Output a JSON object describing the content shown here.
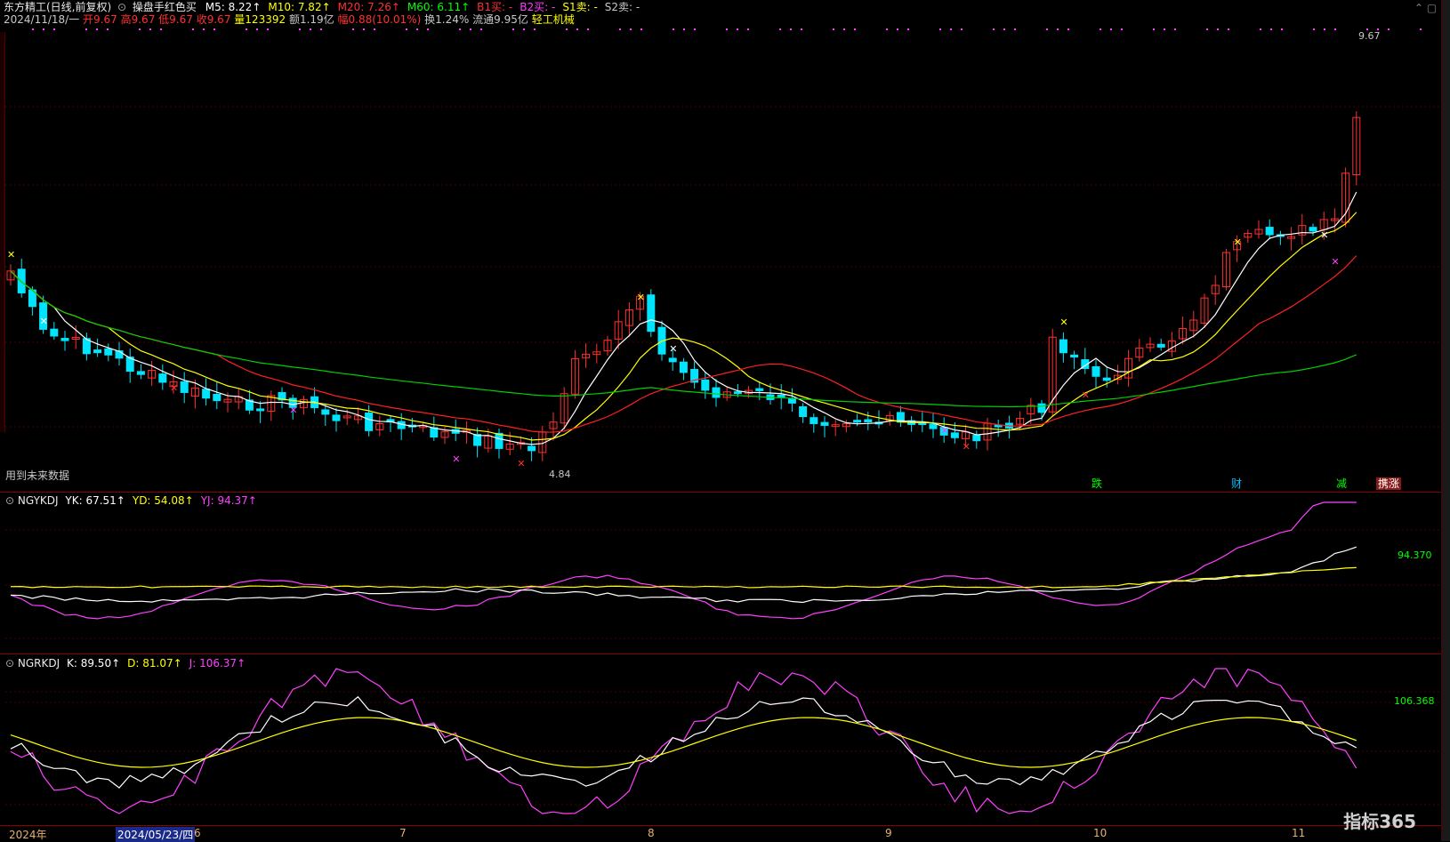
{
  "header": {
    "title": "东方精工(日线,前复权)",
    "indicator_name": "操盘手红色买",
    "ma": [
      {
        "label": "M5:",
        "value": "8.22↑",
        "color": "#ffffff"
      },
      {
        "label": "M10:",
        "value": "7.82↑",
        "color": "#ffff00"
      },
      {
        "label": "M20:",
        "value": "7.26↑",
        "color": "#ff3030"
      },
      {
        "label": "M60:",
        "value": "6.11↑",
        "color": "#00ff00"
      },
      {
        "label": "B1买:",
        "value": "-",
        "color": "#ff3030"
      },
      {
        "label": "B2买:",
        "value": "-",
        "color": "#ff40ff"
      },
      {
        "label": "S1卖:",
        "value": "-",
        "color": "#ffff00"
      },
      {
        "label": "S2卖:",
        "value": "-",
        "color": "#c8c8c8"
      }
    ]
  },
  "quote": {
    "date": "2024/11/18/一",
    "open": "开9.67",
    "high": "高9.67",
    "low": "低9.67",
    "close": "收9.67",
    "volume": "量123392",
    "amount": "额1.19亿",
    "change": "幅0.88(10.01%)",
    "turnover": "换1.24%",
    "float": "流通9.95亿",
    "sector": "轻工机械"
  },
  "main_chart": {
    "note": "用到未来数据",
    "high_label": "9.67",
    "low_label": "4.84",
    "signal_labels": [
      {
        "text": "跌",
        "color": "#00ff00"
      },
      {
        "text": "财",
        "color": "#00c0ff"
      },
      {
        "text": "减",
        "color": "#00ff00"
      },
      {
        "text": "携涨",
        "color": "#ff8040"
      }
    ]
  },
  "panel_ygkdj": {
    "name": "NGYKDJ",
    "items": [
      {
        "label": "YK:",
        "value": "67.51↑",
        "color": "#ffffff"
      },
      {
        "label": "YD:",
        "value": "54.08↑",
        "color": "#ffff00"
      },
      {
        "label": "YJ:",
        "value": "94.37↑",
        "color": "#ff40ff"
      }
    ],
    "right_value": "94.370"
  },
  "panel_grkdj": {
    "name": "NGRKDJ",
    "items": [
      {
        "label": "K:",
        "value": "89.50↑",
        "color": "#ffffff"
      },
      {
        "label": "D:",
        "value": "81.07↑",
        "color": "#ffff00"
      },
      {
        "label": "J:",
        "value": "106.37↑",
        "color": "#ff40ff"
      }
    ],
    "right_value": "106.368"
  },
  "time_axis": {
    "labels": [
      "2024年",
      "2024/05/23/四",
      "6",
      "7",
      "8",
      "9",
      "10",
      "11"
    ]
  },
  "brand": "指标365",
  "colors": {
    "up": "#ff3030",
    "down": "#00e5ff",
    "ma5": "#ffffff",
    "ma10": "#ffff00",
    "ma20": "#ff2020",
    "ma60": "#00d000",
    "k": "#ffffff",
    "d": "#ffff00",
    "j": "#ff40ff"
  }
}
